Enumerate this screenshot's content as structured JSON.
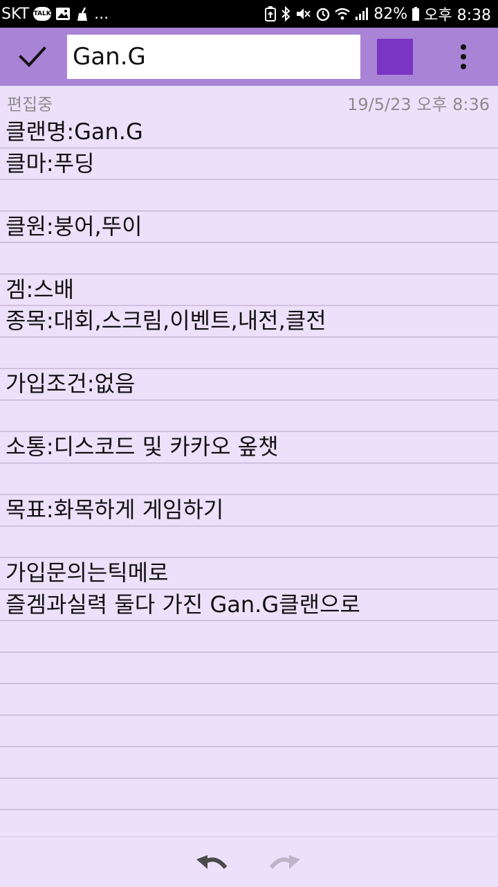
{
  "status_bar": {
    "carrier": "SKT",
    "talk_badge": "TALK",
    "overflow": "...",
    "battery_percent": "82%",
    "time": "오후 8:38"
  },
  "toolbar": {
    "title_value": "Gan.G",
    "color_swatch": "#7b35c4",
    "icons": [
      "check-icon",
      "more-vert-icon"
    ]
  },
  "note": {
    "status": "편집중",
    "datetime": "19/5/23 오후 8:36",
    "lines": [
      "클랜명:Gan.G",
      "클마:푸딩",
      "",
      "클원:붕어,뚜이",
      "",
      "겜:스배",
      "종목:대회,스크림,이벤트,내전,클전",
      "",
      "가입조건:없음",
      "",
      "소통:디스코드 및 카카오 옾챗",
      "",
      "목표:화목하게 게임하기",
      "",
      "가입문의는틱메로",
      "즐겜과실력 둘다 가진 Gan.G클랜으로"
    ]
  },
  "bottom_bar": {
    "icons": [
      "undo-icon",
      "redo-icon"
    ]
  },
  "colors": {
    "toolbar": "#a984d6",
    "background": "#ede0fb",
    "accent": "#7b35c4"
  }
}
